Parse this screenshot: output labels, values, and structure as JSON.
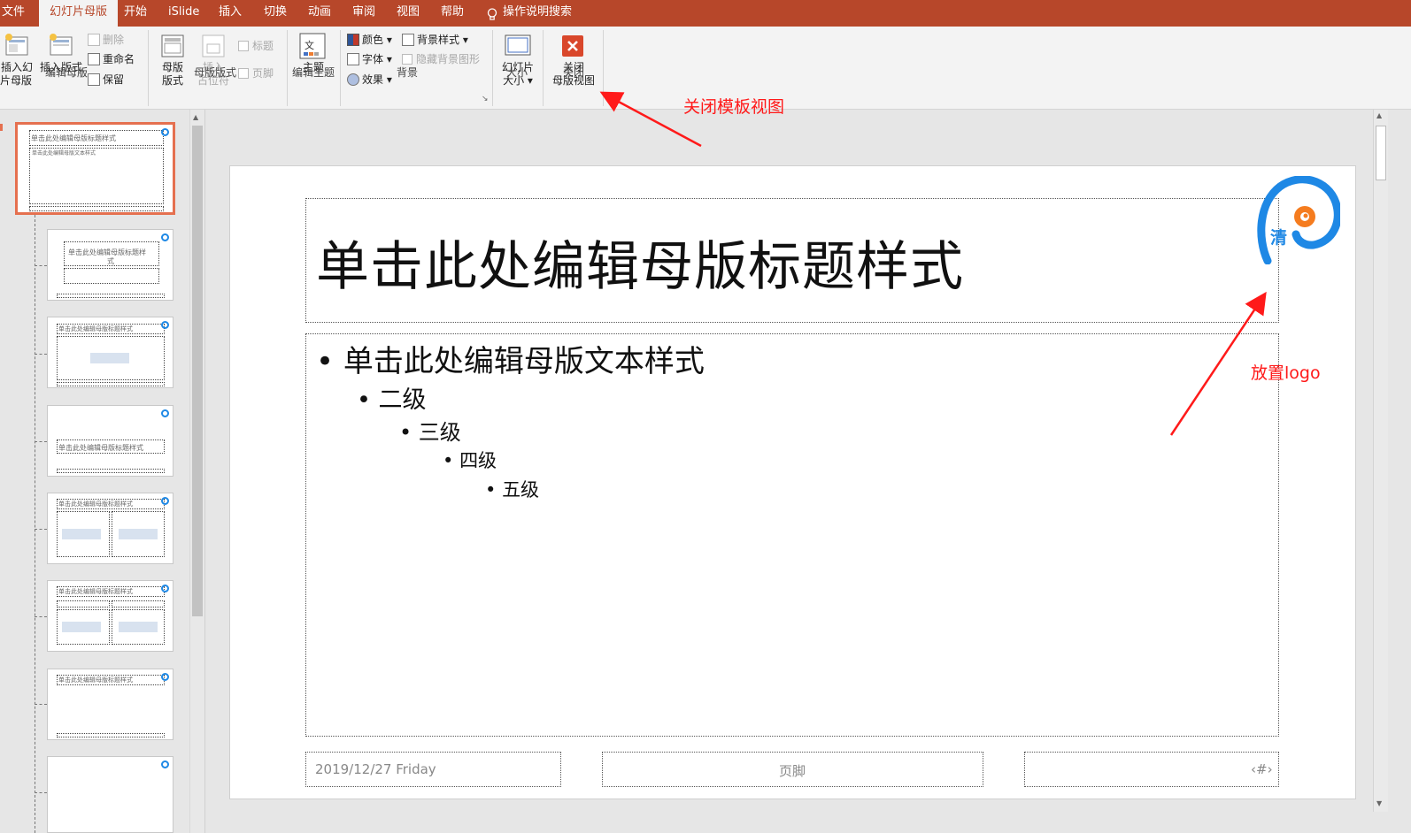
{
  "tabs": {
    "file": "文件",
    "slide_master": "幻灯片母版",
    "home": "开始",
    "islide": "iSlide",
    "insert": "插入",
    "transitions": "切换",
    "animations": "动画",
    "review": "审阅",
    "view": "视图",
    "help": "帮助",
    "tell_me": "操作说明搜索"
  },
  "ribbon": {
    "insert_master_l1": "插入幻",
    "insert_master_l2": "灯片母版",
    "insert_layout": "插入版式",
    "delete": "删除",
    "rename": "重命名",
    "preserve": "保留",
    "group_edit_master": "编辑母版",
    "master_layout_l1": "母版",
    "master_layout_l2": "版式",
    "insert_placeholder_l1": "插入",
    "insert_placeholder_l2": "占位符",
    "title_check": "标题",
    "footer_check": "页脚",
    "group_master_layout": "母版版式",
    "themes": "主题",
    "group_edit_theme": "编辑主题",
    "colors": "颜色",
    "fonts": "字体",
    "effects": "效果",
    "background_styles": "背景样式",
    "hide_bg_graphics": "隐藏背景图形",
    "group_background": "背景",
    "slide_size_l1": "幻灯片",
    "slide_size_l2": "大小",
    "group_size": "大小",
    "close_master_l1": "关闭",
    "close_master_l2": "母版视图",
    "group_close": "关闭"
  },
  "thumbnails": {
    "master_title": "单击此处编辑母版标题样式",
    "master_body": "单击此处编辑母版文本样式",
    "layout2_title": "单击此处编辑母版标题样",
    "layout2_title_b": "式",
    "layout_title_small": "单击此处编辑母版标题样式"
  },
  "slide": {
    "title": "单击此处编辑母版标题样式",
    "level1": "单击此处编辑母版文本样式",
    "level2": "二级",
    "level3": "三级",
    "level4": "四级",
    "level5": "五级",
    "date": "2019/12/27 Friday",
    "footer": "页脚",
    "page_number": "‹#›",
    "logo_char": "清"
  },
  "annotations": {
    "close_master_view": "关闭模板视图",
    "place_logo": "放置logo"
  },
  "colors": {
    "accent": "#b7472a",
    "selection": "#e5704f",
    "annotation": "#ff1a1a",
    "logo_blue": "#1e88e5",
    "logo_orange": "#f57c1f"
  },
  "icons": {
    "tell_me": "lightbulb-icon",
    "close_master": "close-x-icon"
  }
}
